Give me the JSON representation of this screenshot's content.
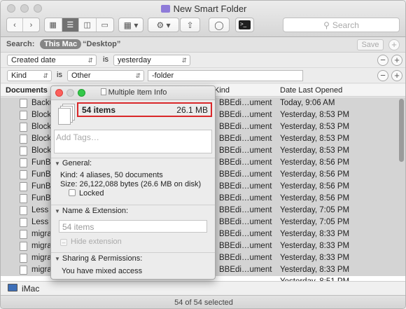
{
  "window": {
    "title": "New Smart Folder"
  },
  "toolbar": {
    "search_placeholder": "Search"
  },
  "search_bar": {
    "label": "Search:",
    "scope_this_mac": "This Mac",
    "scope_desktop": "“Desktop”",
    "save": "Save"
  },
  "criteria": [
    {
      "field": "Created date",
      "op": "is",
      "value": "yesterday"
    },
    {
      "field": "Kind",
      "op": "is",
      "value": "Other",
      "extra": "-folder"
    }
  ],
  "columns": {
    "name": "Documents",
    "kind": "Kind",
    "date": "Date Last Opened"
  },
  "rows": [
    {
      "name": "Backu",
      "kind": "BBEdi…ument",
      "date": "Today, 9:06 AM"
    },
    {
      "name": "Block",
      "kind": "BBEdi…ument",
      "date": "Yesterday, 8:53 PM"
    },
    {
      "name": "Block",
      "kind": "BBEdi…ument",
      "date": "Yesterday, 8:53 PM"
    },
    {
      "name": "Block",
      "kind": "BBEdi…ument",
      "date": "Yesterday, 8:53 PM"
    },
    {
      "name": "Block",
      "kind": "BBEdi…ument",
      "date": "Yesterday, 8:53 PM"
    },
    {
      "name": "FunB",
      "kind": "BBEdi…ument",
      "date": "Yesterday, 8:56 PM"
    },
    {
      "name": "FunB",
      "kind": "BBEdi…ument",
      "date": "Yesterday, 8:56 PM"
    },
    {
      "name": "FunB",
      "kind": "BBEdi…ument",
      "date": "Yesterday, 8:56 PM"
    },
    {
      "name": "FunB",
      "kind": "BBEdi…ument",
      "date": "Yesterday, 8:56 PM"
    },
    {
      "name": "Less",
      "kind": "BBEdi…ument",
      "date": "Yesterday, 7:05 PM"
    },
    {
      "name": "Less",
      "kind": "BBEdi…ument",
      "date": "Yesterday, 7:05 PM"
    },
    {
      "name": "migra",
      "kind": "BBEdi…ument",
      "date": "Yesterday, 8:33 PM"
    },
    {
      "name": "migra",
      "kind": "BBEdi…ument",
      "date": "Yesterday, 8:33 PM"
    },
    {
      "name": "migra",
      "kind": "BBEdi…ument",
      "date": "Yesterday, 8:33 PM"
    },
    {
      "name": "migra",
      "kind": "BBEdi…ument",
      "date": "Yesterday, 8:33 PM"
    },
    {
      "name": "",
      "kind": "",
      "date": "Yesterday, 8:51 PM"
    }
  ],
  "path": {
    "computer": "iMac"
  },
  "status": {
    "text": "54 of 54 selected"
  },
  "info": {
    "title": "Multiple Item Info",
    "count": "54 items",
    "size": "26.1 MB",
    "tags_placeholder": "Add Tags…",
    "general": "General:",
    "kind": "Kind: 4 aliases, 50 documents",
    "size_detail": "Size: 26,122,088 bytes (26.6 MB on disk)",
    "locked": "Locked",
    "name_ext": "Name & Extension:",
    "name_value": "54 items",
    "hide_ext": "Hide extension",
    "sharing": "Sharing & Permissions:",
    "access": "You have mixed access"
  }
}
